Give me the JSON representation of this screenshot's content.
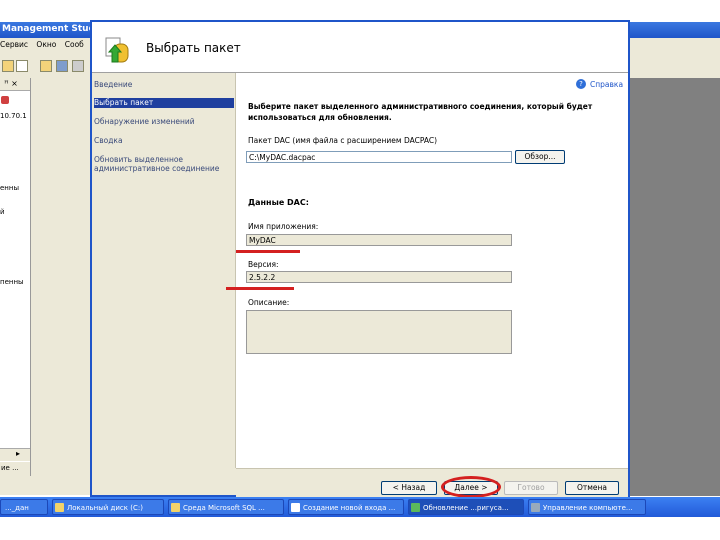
{
  "background_app": {
    "title": "Management Studio",
    "menu": [
      "Сервис",
      "Окно",
      "Сооб"
    ],
    "panel_header": "ꟸ ×",
    "tree_items": [
      "10.70.1",
      "енны",
      "й",
      "пенны"
    ],
    "status": "ие ..."
  },
  "dialog": {
    "title": "Выбрать пакет",
    "help": "Справка",
    "nav": [
      {
        "label": "Введение",
        "active": false
      },
      {
        "label": "Выбрать пакет",
        "active": true
      },
      {
        "label": "Обнаружение изменений",
        "active": false
      },
      {
        "label": "Сводка",
        "active": false
      },
      {
        "label": "Обновить выделенное",
        "active": false
      },
      {
        "label": "административное соединение",
        "active": false
      }
    ],
    "instruction_line1": "Выберите пакет выделенного административного соединения, который будет",
    "instruction_line2": "использоваться для обновления.",
    "package_label": "Пакет DAC (имя файла с расширением DACPAC)",
    "package_value": "C:\\MyDAC.dacpac",
    "browse_button": "Обзор...",
    "dac_section": "Данные DAC:",
    "app_name_label": "Имя приложения:",
    "app_name_value": "MyDAC",
    "version_label": "Версия:",
    "version_value": "2.5.2.2",
    "description_label": "Описание:",
    "description_value": "",
    "buttons": {
      "back": "< Назад",
      "next": "Далее >",
      "finish": "Готово",
      "cancel": "Отмена"
    }
  },
  "taskbar": [
    {
      "label": "..._дан",
      "active": false
    },
    {
      "label": "Локальный диск (C:)",
      "active": false
    },
    {
      "label": "Среда Microsoft SQL ...",
      "active": false
    },
    {
      "label": "Создание новой входа ...",
      "active": false
    },
    {
      "label": "Обновление ...ригуса...",
      "active": true
    },
    {
      "label": "Управление компьюте...",
      "active": false
    }
  ],
  "colors": {
    "accent": "#1f55c9",
    "annotation": "#d42020",
    "nav_active": "#1f3f9f"
  }
}
